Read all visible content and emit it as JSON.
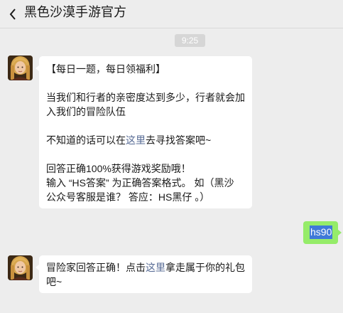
{
  "header": {
    "title": "黑色沙漠手游官方"
  },
  "chat": {
    "timestamp": "9:25",
    "message1": {
      "line_heading": "【每日一题，每日领福利】",
      "line_question_1": "当我们和行者的亲密度达到多少，行者就会加",
      "line_question_2": "入我们的冒险队伍",
      "line_hint_before": "不知道的话可以在",
      "line_hint_link": "这里",
      "line_hint_after": "去寻找答案吧~",
      "line_reward": "回答正确100%获得游戏奖励哦！",
      "line_format_1": "输入 “HS答案” 为正确答案格式。 如（黑沙",
      "line_format_2": "公众号客服是谁？ 答应：HS黑仔 。）"
    },
    "reply": {
      "text": "hs90"
    },
    "message2": {
      "line1_before": "冒险家回答正确！点击",
      "line1_link": "这里",
      "line1_after": "拿走属于你的礼包",
      "line2": "吧~"
    }
  },
  "colors": {
    "background": "#ededed",
    "bubble_in": "#ffffff",
    "bubble_out": "#95ec69",
    "link": "#576b95",
    "selection": "#3f79d8"
  },
  "icons": {
    "back": "chevron-left-icon",
    "avatar": "character-avatar"
  }
}
